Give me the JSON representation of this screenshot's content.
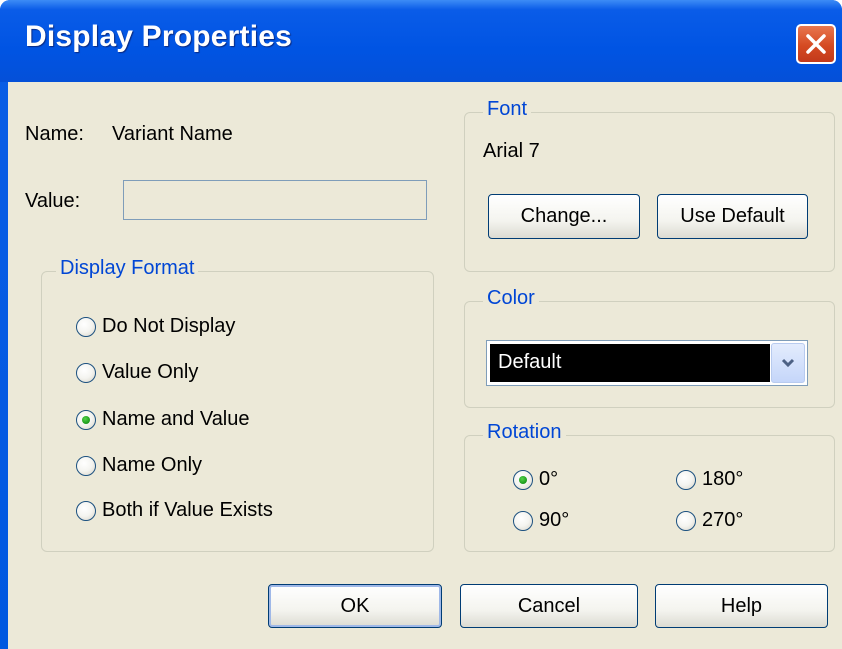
{
  "window": {
    "title": "Display Properties"
  },
  "fields": {
    "name_label": "Name:",
    "name_value": "Variant Name",
    "value_label": "Value:",
    "value_text": ""
  },
  "display_format": {
    "title": "Display Format",
    "options": [
      {
        "label": "Do Not Display",
        "selected": false
      },
      {
        "label": "Value Only",
        "selected": false
      },
      {
        "label": "Name and Value",
        "selected": true
      },
      {
        "label": "Name Only",
        "selected": false
      },
      {
        "label": "Both if Value Exists",
        "selected": false
      }
    ]
  },
  "font": {
    "title": "Font",
    "current": "Arial 7",
    "change_label": "Change...",
    "use_default_label": "Use Default"
  },
  "color": {
    "title": "Color",
    "selected": "Default"
  },
  "rotation": {
    "title": "Rotation",
    "options": [
      {
        "label": "0°",
        "selected": true
      },
      {
        "label": "180°",
        "selected": false
      },
      {
        "label": "90°",
        "selected": false
      },
      {
        "label": "270°",
        "selected": false
      }
    ]
  },
  "buttons": {
    "ok": "OK",
    "cancel": "Cancel",
    "help": "Help"
  },
  "colors": {
    "titlebar": "#0054e3",
    "dialog_bg": "#ece9d8",
    "group_title": "#0046d5",
    "radio_selected": "#21a121",
    "close_button": "#d54a22"
  },
  "icons": {
    "close": "close-icon",
    "dropdown": "chevron-down-icon"
  }
}
